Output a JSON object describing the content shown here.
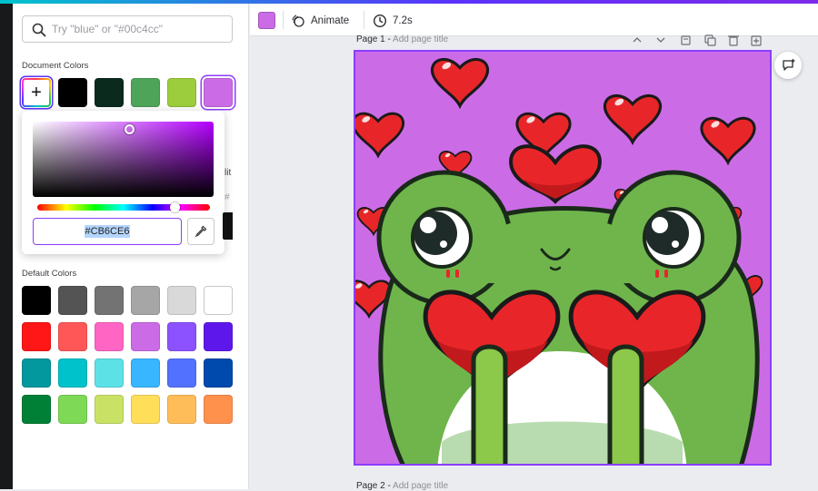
{
  "search": {
    "placeholder": "Try \"blue\" or \"#00c4cc\""
  },
  "document_colors": {
    "label": "Document Colors",
    "add_label": "+",
    "swatches": [
      "#000000",
      "#0a2a1e",
      "#4ea55a",
      "#9ccd3d",
      "#cb6ce6"
    ],
    "selected": "#cb6ce6"
  },
  "picker": {
    "hex_value": "#CB6CE6"
  },
  "peek": {
    "text_1": "lit",
    "text_2": "#"
  },
  "default_colors": {
    "label": "Default Colors",
    "rows": [
      [
        "#000000",
        "#545454",
        "#737373",
        "#a6a6a6",
        "#d9d9d9",
        "#ffffff"
      ],
      [
        "#ff1616",
        "#ff5757",
        "#ff66c4",
        "#cb6ce6",
        "#8c52ff",
        "#5e17eb"
      ],
      [
        "#03989e",
        "#00c2cb",
        "#5ce1e6",
        "#38b6ff",
        "#5271ff",
        "#004aad"
      ],
      [
        "#008037",
        "#7ed957",
        "#c9e265",
        "#ffde59",
        "#ffbd59",
        "#ff914d"
      ]
    ]
  },
  "toolbar": {
    "color": "#cb6ce6",
    "animate_label": "Animate",
    "duration_label": "7.2s"
  },
  "page1": {
    "prefix": "Page 1 - ",
    "title_placeholder": "Add page title"
  },
  "page2": {
    "prefix": "Page 2 - ",
    "title_placeholder": "Add page title"
  },
  "icons": {
    "search": "search-icon",
    "eyedropper": "eyedropper-icon",
    "animate": "animate-icon",
    "timer": "timer-icon",
    "comment": "add-comment-icon"
  }
}
